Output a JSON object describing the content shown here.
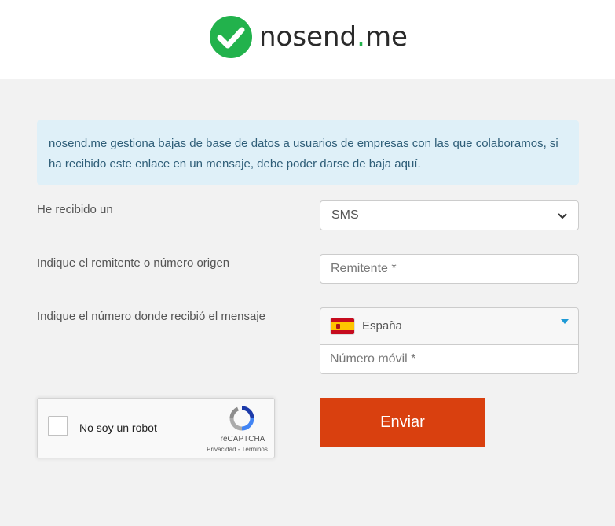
{
  "brand": {
    "name_main": "nosend",
    "name_dot": ".",
    "name_tld": "me",
    "check_color": "#22b24c"
  },
  "info": {
    "text": "nosend.me gestiona bajas de base de datos a usuarios de empresas con las que colaboramos, si ha recibido este enlace en un mensaje, debe poder darse de baja aquí."
  },
  "form": {
    "received_label": "He recibido un",
    "received_value": "SMS",
    "sender_label": "Indique el remitente o número origen",
    "sender_placeholder": "Remitente *",
    "number_label": "Indique el número donde recibió el mensaje",
    "country_name": "España",
    "phone_placeholder": "Número móvil *",
    "submit_label": "Enviar",
    "submit_color": "#d9400f"
  },
  "captcha": {
    "label": "No soy un robot",
    "brand": "reCAPTCHA",
    "links": "Privacidad - Términos"
  }
}
